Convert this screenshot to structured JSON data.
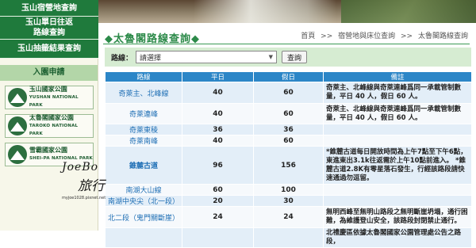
{
  "sidebar": {
    "nav": [
      {
        "label": "玉山宿營地查詢"
      },
      {
        "label_line1": "玉山單日往返",
        "label_line2": "路線查詢"
      },
      {
        "label": "玉山抽籤結果查詢"
      }
    ],
    "apply_label": "入園申請",
    "parks": [
      {
        "zh": "玉山國家公園",
        "en": "YUSHAN NATIONAL PARK"
      },
      {
        "zh": "太魯閣國家公園",
        "en": "TAROKO NATIONAL PARK"
      },
      {
        "zh": "雪霸國家公園",
        "en": "SHEI-PA NATIONAL PARK"
      }
    ]
  },
  "watermark": {
    "line1": "JoeBo",
    "line2": "旅行",
    "url": "myjoe1028.pixnet.net"
  },
  "header": {
    "title": "◆太魯閣路線查詢◆",
    "breadcrumb": [
      "首頁",
      ">>",
      "宿營地與床位查詢",
      ">>",
      "太魯閣路線查詢"
    ]
  },
  "search": {
    "label": "路線：",
    "select_value": "請選擇",
    "button_label": "查詢"
  },
  "table": {
    "headers": [
      "路線",
      "平日",
      "假日",
      "備註"
    ],
    "rows": [
      {
        "route": "奇萊主、北峰線",
        "weekday": "40",
        "holiday": "60",
        "note": "奇萊主、北峰線與奇萊連峰爲同一承載管制數量，平日 40 人，假日 60 人。"
      },
      {
        "route": "奇萊連峰",
        "weekday": "40",
        "holiday": "60",
        "note": "奇萊主、北峰線與奇萊連峰爲同一承載管制數量，平日 40 人，假日 60 人。"
      },
      {
        "route": "奇萊東稜",
        "weekday": "36",
        "holiday": "36",
        "note": ""
      },
      {
        "route": "奇萊南峰",
        "weekday": "40",
        "holiday": "60",
        "note": ""
      },
      {
        "route": "錐麓古道",
        "weekday": "96",
        "holiday": "156",
        "note": "*錐麓古道每日開放時間為上午7點至下午6點，東進東出3.1k往返需於上午10點前進入。 *錐麓古道2.8K有零星落石發生，行經該路段請快速通過勿逗留。"
      },
      {
        "route": "南湖大山線",
        "weekday": "60",
        "holiday": "100",
        "note": ""
      },
      {
        "route": "南湖中央尖（北一段）",
        "weekday": "20",
        "holiday": "30",
        "note": ""
      },
      {
        "route": "北二段（鬼門關斷崖）",
        "weekday": "24",
        "holiday": "24",
        "note": "無明西峰至無明山路段之無明斷崖坍塌，通行困難，為維護登山安全，該路段封閉禁止通行。"
      },
      {
        "route": "",
        "weekday": "",
        "holiday": "",
        "note": "北禮慶區依據太魯閣國家公園管理處公告之路段，"
      }
    ]
  },
  "colors": {
    "nav_green": "#1f7a3c",
    "title_green": "#2c8a49",
    "table_header_blue": "#2c86c7",
    "row_blue": "#e3eef8",
    "link_blue": "#1f6fb5"
  }
}
